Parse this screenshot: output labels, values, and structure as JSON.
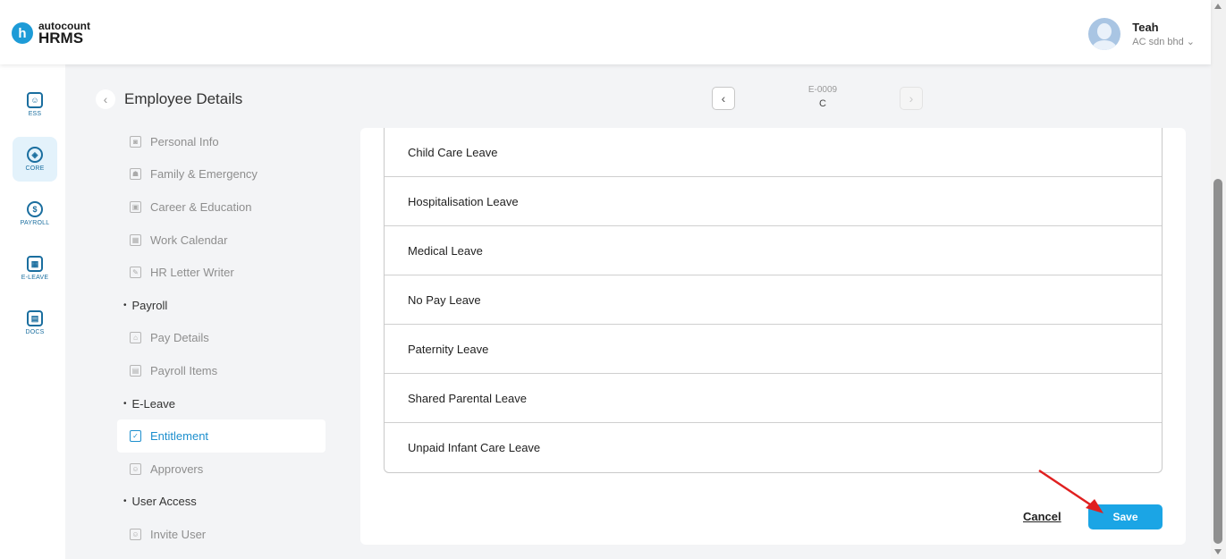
{
  "app": {
    "logo_letter": "h",
    "logo_brand": "autocount",
    "logo_product": "HRMS"
  },
  "user": {
    "name": "Teah",
    "company": "AC sdn bhd"
  },
  "rail": [
    {
      "label": "ESS",
      "icon": "ess-icon"
    },
    {
      "label": "CORE",
      "icon": "core-icon"
    },
    {
      "label": "PAYROLL",
      "icon": "payroll-icon"
    },
    {
      "label": "E-LEAVE",
      "icon": "eleave-icon"
    },
    {
      "label": "DOCS",
      "icon": "docs-icon"
    }
  ],
  "header": {
    "title": "Employee Details",
    "employee_id": "E-0009",
    "employee_name": "C"
  },
  "sidenav": {
    "personal_info": "Personal Info",
    "family": "Family & Emergency",
    "career": "Career & Education",
    "work_calendar": "Work Calendar",
    "hr_letter": "HR Letter Writer",
    "section_payroll": "Payroll",
    "pay_details": "Pay Details",
    "payroll_items": "Payroll Items",
    "section_eleave": "E-Leave",
    "entitlement": "Entitlement",
    "approvers": "Approvers",
    "section_user_access": "User Access",
    "invite_user": "Invite User"
  },
  "leave_types": [
    "Child Care Leave",
    "Hospitalisation Leave",
    "Medical Leave",
    "No Pay Leave",
    "Paternity Leave",
    "Shared Parental Leave",
    "Unpaid Infant Care Leave"
  ],
  "actions": {
    "cancel": "Cancel",
    "save": "Save"
  },
  "colors": {
    "accent": "#1ba5e5",
    "annotation": "#e02020"
  }
}
